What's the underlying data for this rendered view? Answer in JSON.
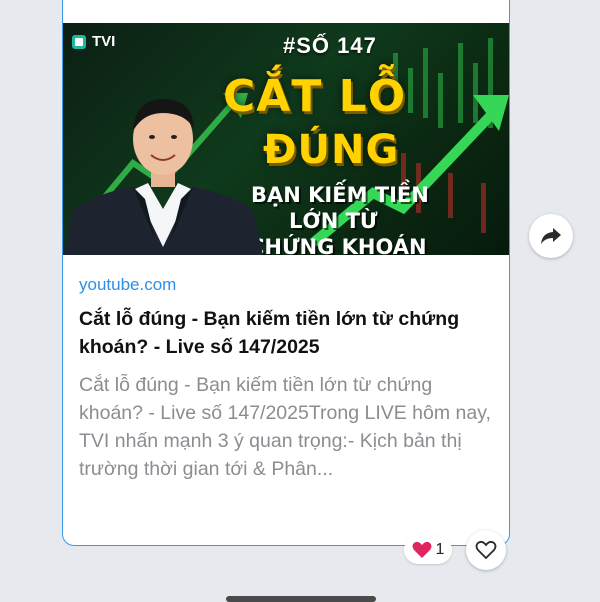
{
  "message": {
    "thumbnail": {
      "brand": "TVI",
      "episode": "#SỐ 147",
      "headline_1": "CẮT LỖ",
      "headline_2": "ĐÚNG",
      "sub_1": "BẠN KIẾM TIỀN",
      "sub_2": "LỚN TỪ",
      "sub_3": "CHỨNG KHOÁN"
    },
    "domain": "youtube.com",
    "title": "Cắt lỗ đúng - Bạn kiếm tiền lớn từ chứng khoán? - Live số 147/2025",
    "description": "Cắt lỗ đúng - Bạn kiếm tiền lớn từ chứng khoán? - Live số 147/2025Trong LIVE hôm nay, TVI nhấn mạnh 3 ý quan trọng:- Kịch bản thị trường thời gian tới & Phân...",
    "reaction": {
      "emoji": "❤️",
      "count": "1"
    }
  },
  "icons": {
    "share": "share-arrow-icon",
    "like": "heart-outline-icon",
    "reaction": "heart-filled-icon"
  },
  "colors": {
    "accent": "#3b9bea",
    "link": "#2f8fe6",
    "headline": "#ffd200",
    "reaction": "#e0245e"
  }
}
